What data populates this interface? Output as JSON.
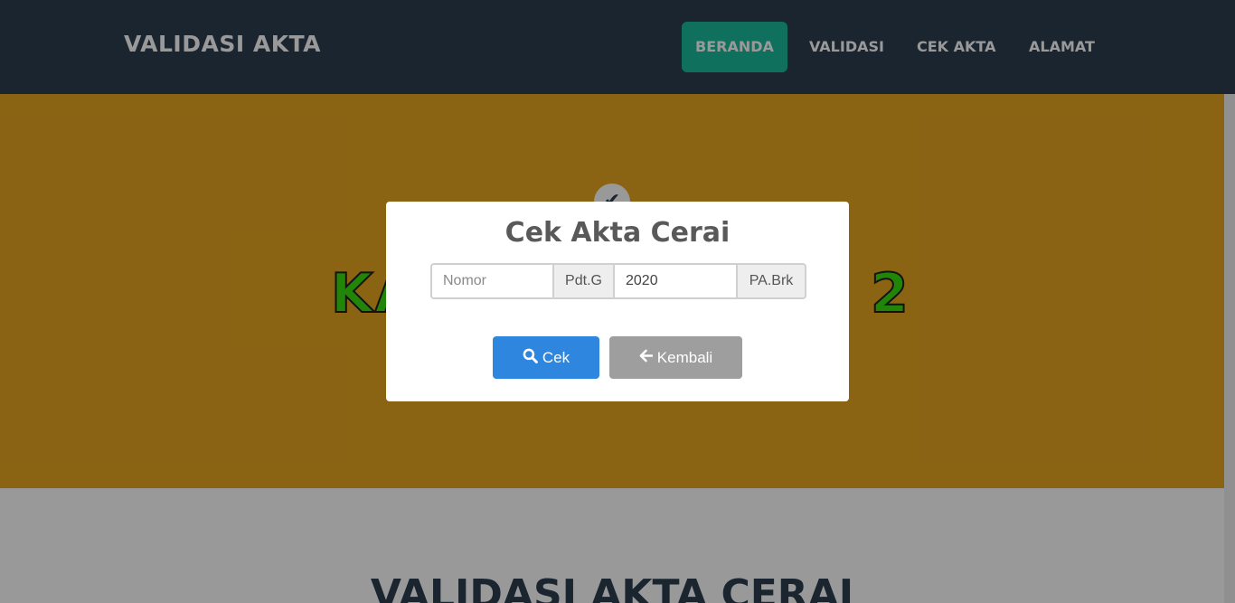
{
  "navbar": {
    "brand": "VALIDASI AKTA",
    "items": [
      {
        "label": "BERANDA",
        "active": true
      },
      {
        "label": "VALIDASI",
        "active": false
      },
      {
        "label": "CEK AKTA",
        "active": false
      },
      {
        "label": "ALAMAT",
        "active": false
      }
    ]
  },
  "masthead": {
    "badge_icon": "check-icon",
    "title_visible_left": "KA",
    "title_visible_right": "2"
  },
  "section": {
    "title": "VALIDASI AKTA CERAI"
  },
  "modal": {
    "title": "Cek Akta Cerai",
    "nomor": {
      "placeholder": "Nomor",
      "value": ""
    },
    "addon_type": "Pdt.G",
    "tahun": {
      "value": "2020"
    },
    "addon_court": "PA.Brk",
    "buttons": {
      "cek": {
        "label": "Cek",
        "icon": "search-icon"
      },
      "kembali": {
        "label": "Kembali",
        "icon": "arrow-left-icon"
      }
    }
  },
  "colors": {
    "navbar": "#2c3e50",
    "active_nav": "#1abc9c",
    "masthead": "#e6a521",
    "hero_text": "#38e00c",
    "btn_cek": "#2e86de",
    "btn_kembali": "#9e9e9e"
  }
}
